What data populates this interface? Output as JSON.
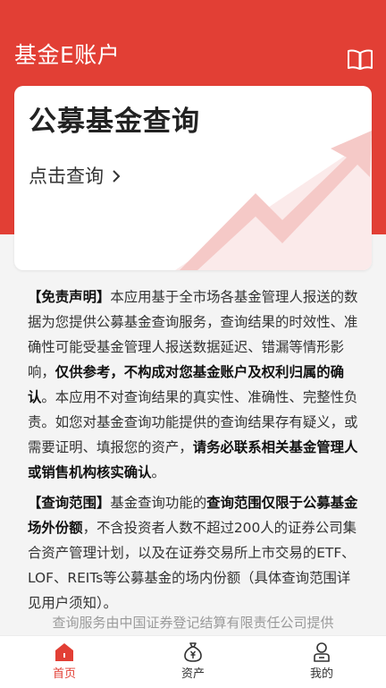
{
  "colors": {
    "brand": "#e23f35",
    "background": "#f4f4f4",
    "card": "#ffffff",
    "text": "#333333",
    "muted": "#9a9a9a"
  },
  "header": {
    "title": "基金E账户",
    "book_icon": "book-icon"
  },
  "card": {
    "title": "公募基金查询",
    "action_label": "点击查询",
    "action_icon": "chevron-right-icon"
  },
  "disclaimer": {
    "tag": "【免责声明】",
    "text_1": "本应用基于全市场各基金管理人报送的数据为您提供公募基金查询服务，查询结果的时效性、准确性可能受基金管理人报送数据延迟、错漏等情形影响，",
    "bold_1": "仅供参考，不构成对您基金账户及权利归属的确认",
    "text_2": "。本应用不对查询结果的真实性、准确性、完整性负责。如您对基金查询功能提供的查询结果存有疑义，或需要证明、填报您的资产，",
    "bold_2": "请务必联系相关基金管理人或销售机构核实确认",
    "text_3": "。"
  },
  "scope": {
    "tag": "【查询范围】",
    "text_1": "基金查询功能的",
    "bold_1": "查询范围仅限于公募基金场外份额",
    "text_2": "，不含投资者人数不超过200人的证券公司集合资产管理计划，以及在证券交易所上市交易的ETF、LOF、REITs等公募基金的场内份额（具体查询范围详见用户须知）。"
  },
  "provider": "查询服务由中国证券登记结算有限责任公司提供",
  "tabbar": {
    "items": [
      {
        "label": "首页",
        "icon": "home-icon",
        "active": true
      },
      {
        "label": "资产",
        "icon": "money-bag-icon",
        "active": false
      },
      {
        "label": "我的",
        "icon": "user-icon",
        "active": false
      }
    ]
  }
}
